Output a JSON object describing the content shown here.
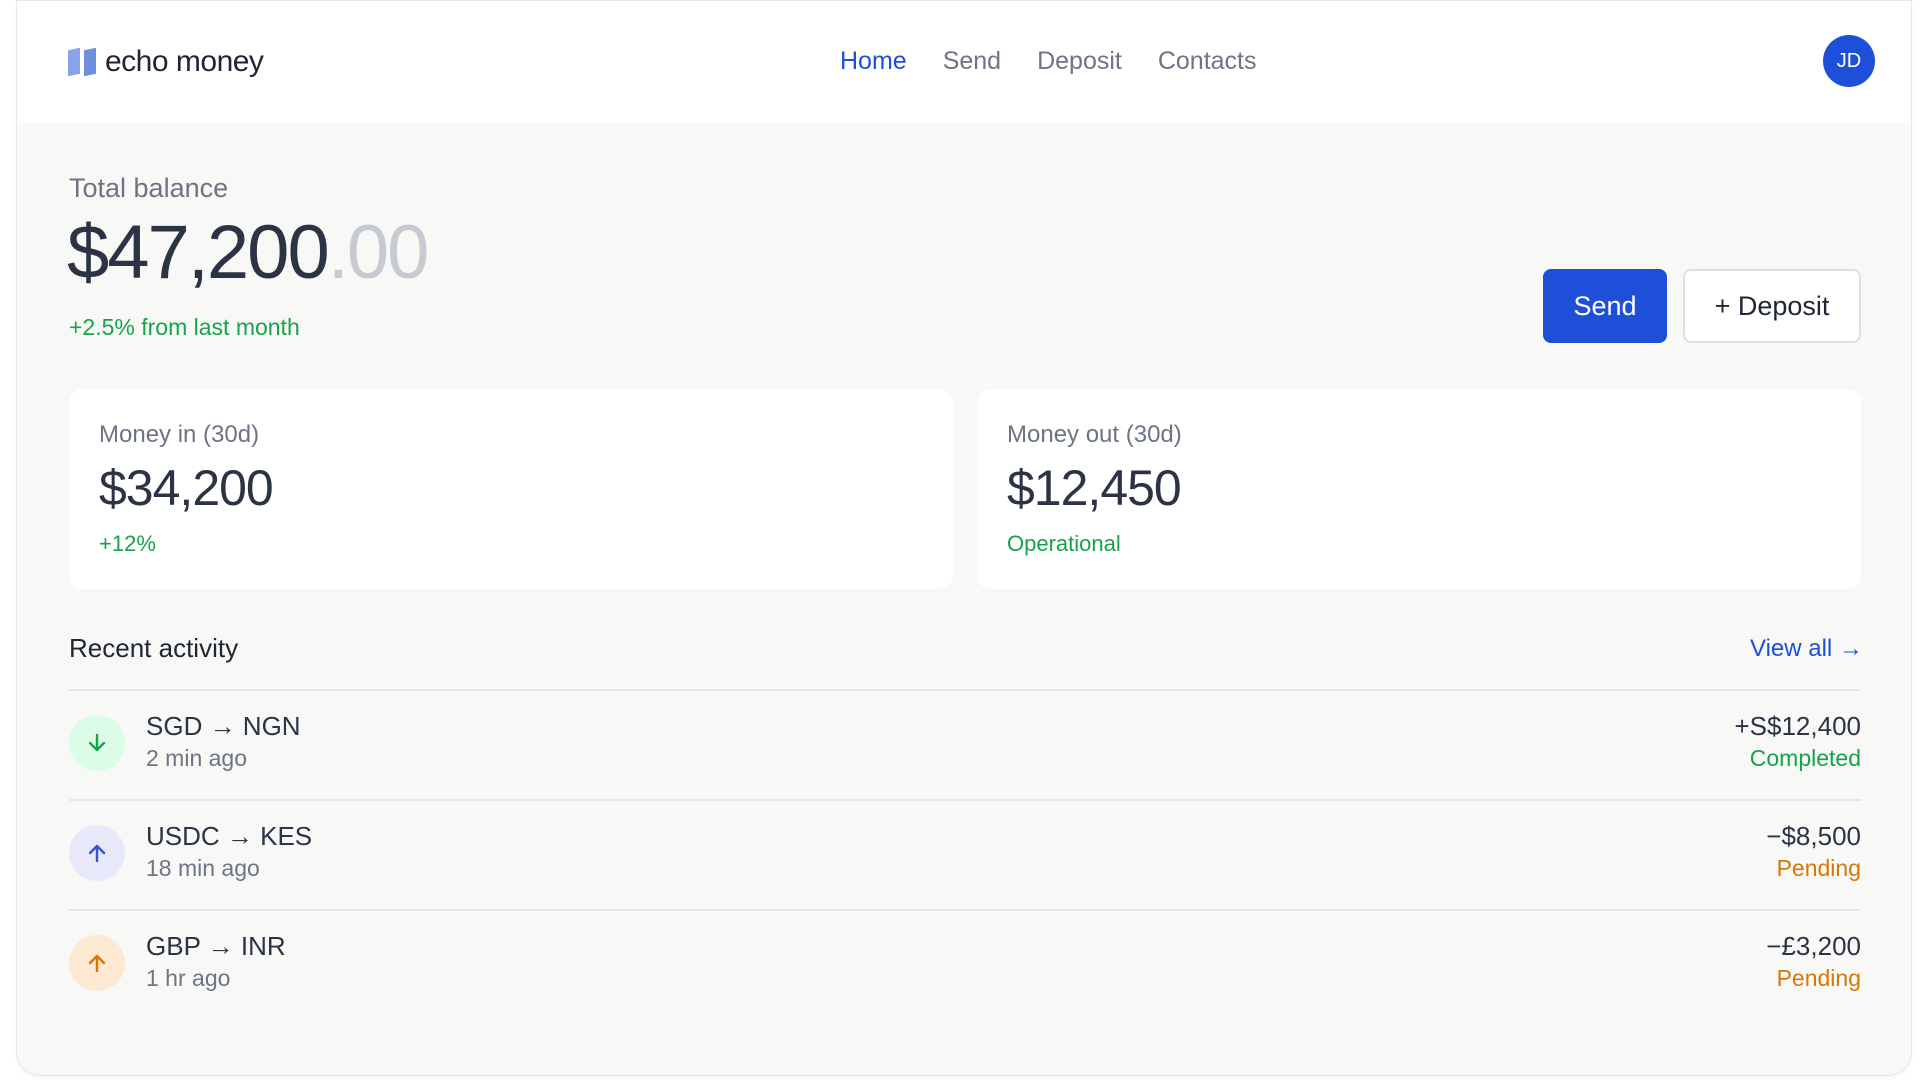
{
  "brand": {
    "name": "echo money"
  },
  "nav": [
    {
      "label": "Home",
      "active": true
    },
    {
      "label": "Send",
      "active": false
    },
    {
      "label": "Deposit",
      "active": false
    },
    {
      "label": "Contacts",
      "active": false
    }
  ],
  "user": {
    "initials": "JD"
  },
  "balance": {
    "label": "Total balance",
    "whole": "$47,200",
    "cents": ".00",
    "change": "+2.5% from last month"
  },
  "actions": {
    "send_label": "Send",
    "deposit_label": "+ Deposit"
  },
  "cards": {
    "money_in": {
      "label": "Money in (30d)",
      "value": "$34,200",
      "sub": "+12%"
    },
    "money_out": {
      "label": "Money out (30d)",
      "value": "$12,450",
      "sub": "Operational"
    }
  },
  "activity": {
    "title": "Recent activity",
    "view_all": "View all →",
    "items": [
      {
        "pair": "SGD → NGN",
        "time": "2 min ago",
        "amount": "+S$12,400",
        "status": "Completed",
        "direction": "down",
        "icon": "arrow-down-icon"
      },
      {
        "pair": "USDC → KES",
        "time": "18 min ago",
        "amount": "−$8,500",
        "status": "Pending",
        "direction": "up",
        "icon": "arrow-up-icon"
      },
      {
        "pair": "GBP → INR",
        "time": "1 hr ago",
        "amount": "−£3,200",
        "status": "Pending",
        "direction": "up",
        "icon": "arrow-up-icon"
      }
    ]
  },
  "colors": {
    "accent": "#1d4fd8",
    "positive": "#16a34a",
    "pending": "#d97706",
    "icon_bg_green": "#dcfce7",
    "icon_bg_purple": "#e8e8fb",
    "icon_bg_orange": "#fde8d2"
  }
}
